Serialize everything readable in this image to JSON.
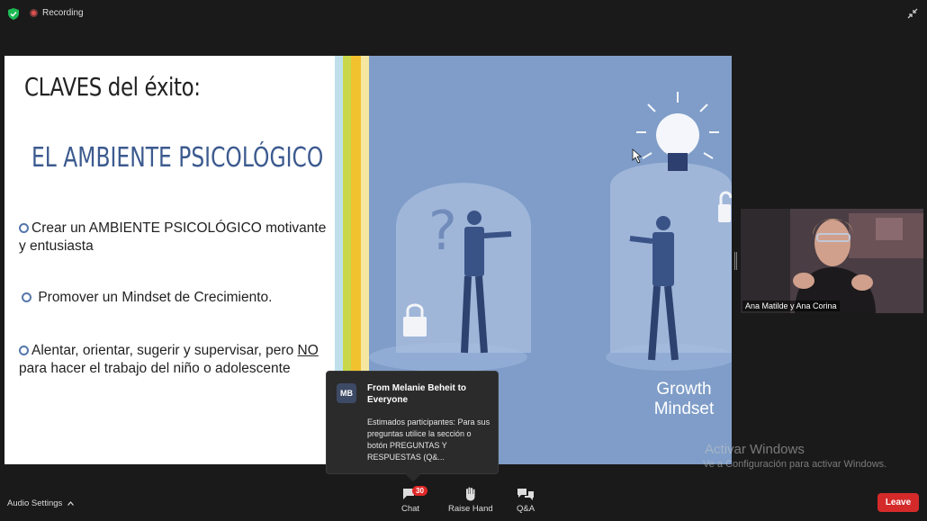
{
  "topbar": {
    "recording_label": "Recording"
  },
  "slide": {
    "title": "CLAVES del éxito:",
    "subtitle": "EL AMBIENTE PSICOLÓGICO",
    "bullet1": "Crear un AMBIENTE PSICOLÓGICO motivante y entusiasta",
    "bullet2": "Promover un Mindset de Crecimiento.",
    "bullet3_pre": "Alentar, orientar, sugerir y supervisar, pero ",
    "bullet3_underline": "NO",
    "bullet3_post": " para hacer el trabajo del niño o adolescente",
    "growth_label_1": "Growth",
    "growth_label_2": "Mindset",
    "stripe_colors": [
      "#bfe0ea",
      "#c8d84a",
      "#f2c12e",
      "#f6e7a0"
    ]
  },
  "participant": {
    "name": "Ana Matilde y Ana Corina"
  },
  "chat_notification": {
    "avatar_initials": "MB",
    "from": "From Melanie Beheit to Everyone",
    "message": "Estimados participantes: Para sus preguntas utilice la sección o botón PREGUNTAS Y RESPUESTAS (Q&..."
  },
  "watermark": {
    "line1": "Activar Windows",
    "line2": "Ve a Configuración para activar Windows."
  },
  "toolbar": {
    "audio_settings": "Audio Settings",
    "chat_label": "Chat",
    "chat_badge": "30",
    "raise_hand_label": "Raise Hand",
    "qa_label": "Q&A",
    "leave_label": "Leave"
  },
  "colors": {
    "leave": "#d42a2a",
    "slide_blue": "#7f9dc8",
    "subtitle_blue": "#3c5a8f"
  }
}
